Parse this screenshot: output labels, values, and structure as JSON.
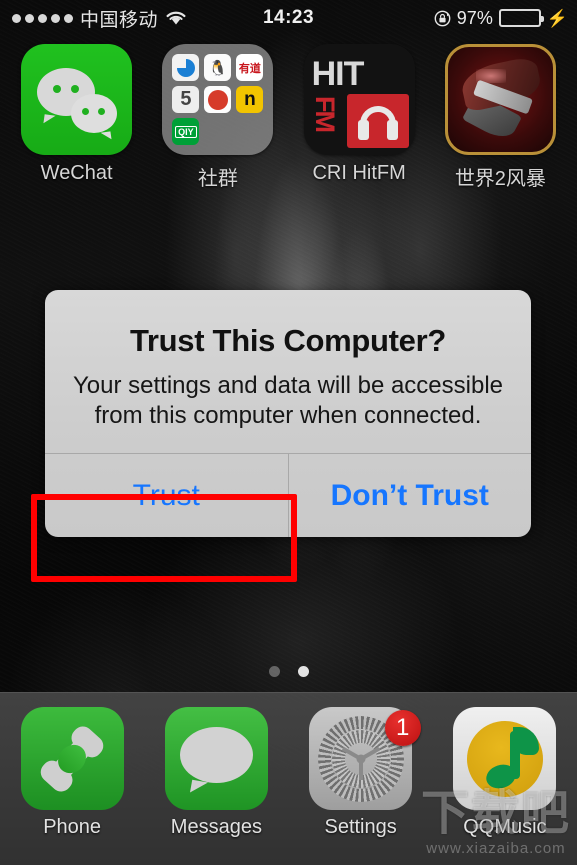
{
  "status_bar": {
    "signal_dots": 5,
    "carrier": "中国移动",
    "wifi_icon": "wifi-icon",
    "time": "14:23",
    "lock_icon": "rotation-lock-icon",
    "battery_percent": "97%",
    "battery_level": 97,
    "charging_icon": "lightning-bolt-icon"
  },
  "home_screen": {
    "apps": [
      {
        "label": "WeChat",
        "icon": "wechat-icon"
      },
      {
        "label": "社群",
        "icon": "folder-icon"
      },
      {
        "label": "CRI HitFM",
        "icon": "cri-hitfm-icon"
      },
      {
        "label": "世界2风暴",
        "icon": "shijie2fengbao-icon"
      }
    ],
    "folder_mini_icons": [
      "browser-icon",
      "qq-icon",
      "youdao-icon",
      "five-icon",
      "bird-icon",
      "n-icon",
      "qiyi-icon"
    ],
    "folder_mini_labels": [
      "",
      "",
      "有道",
      "5",
      "",
      "n",
      "QIY"
    ],
    "page_dots": {
      "count": 2,
      "active_index": 1
    }
  },
  "dock": {
    "apps": [
      {
        "label": "Phone",
        "icon": "phone-icon",
        "badge": ""
      },
      {
        "label": "Messages",
        "icon": "messages-icon",
        "badge": ""
      },
      {
        "label": "Settings",
        "icon": "gear-icon",
        "badge": "1"
      },
      {
        "label": "QQMusic",
        "icon": "qqmusic-icon",
        "badge": ""
      }
    ]
  },
  "alert": {
    "title": "Trust This Computer?",
    "message": "Your settings and data will be accessible from this computer when connected.",
    "buttons": [
      {
        "label": "Trust",
        "highlighted": true
      },
      {
        "label": "Don’t Trust",
        "highlighted": false
      }
    ]
  },
  "annotation": {
    "target": "Trust",
    "color": "#ff0000"
  },
  "watermark": {
    "text": "下载吧",
    "url": "www.xiazaiba.com"
  },
  "colors": {
    "accent_blue": "#1676ff",
    "annotation_red": "#ff0000",
    "badge_red": "#cc1616",
    "wechat_green": "#1ab91a",
    "battery_green": "#3fa63f"
  }
}
